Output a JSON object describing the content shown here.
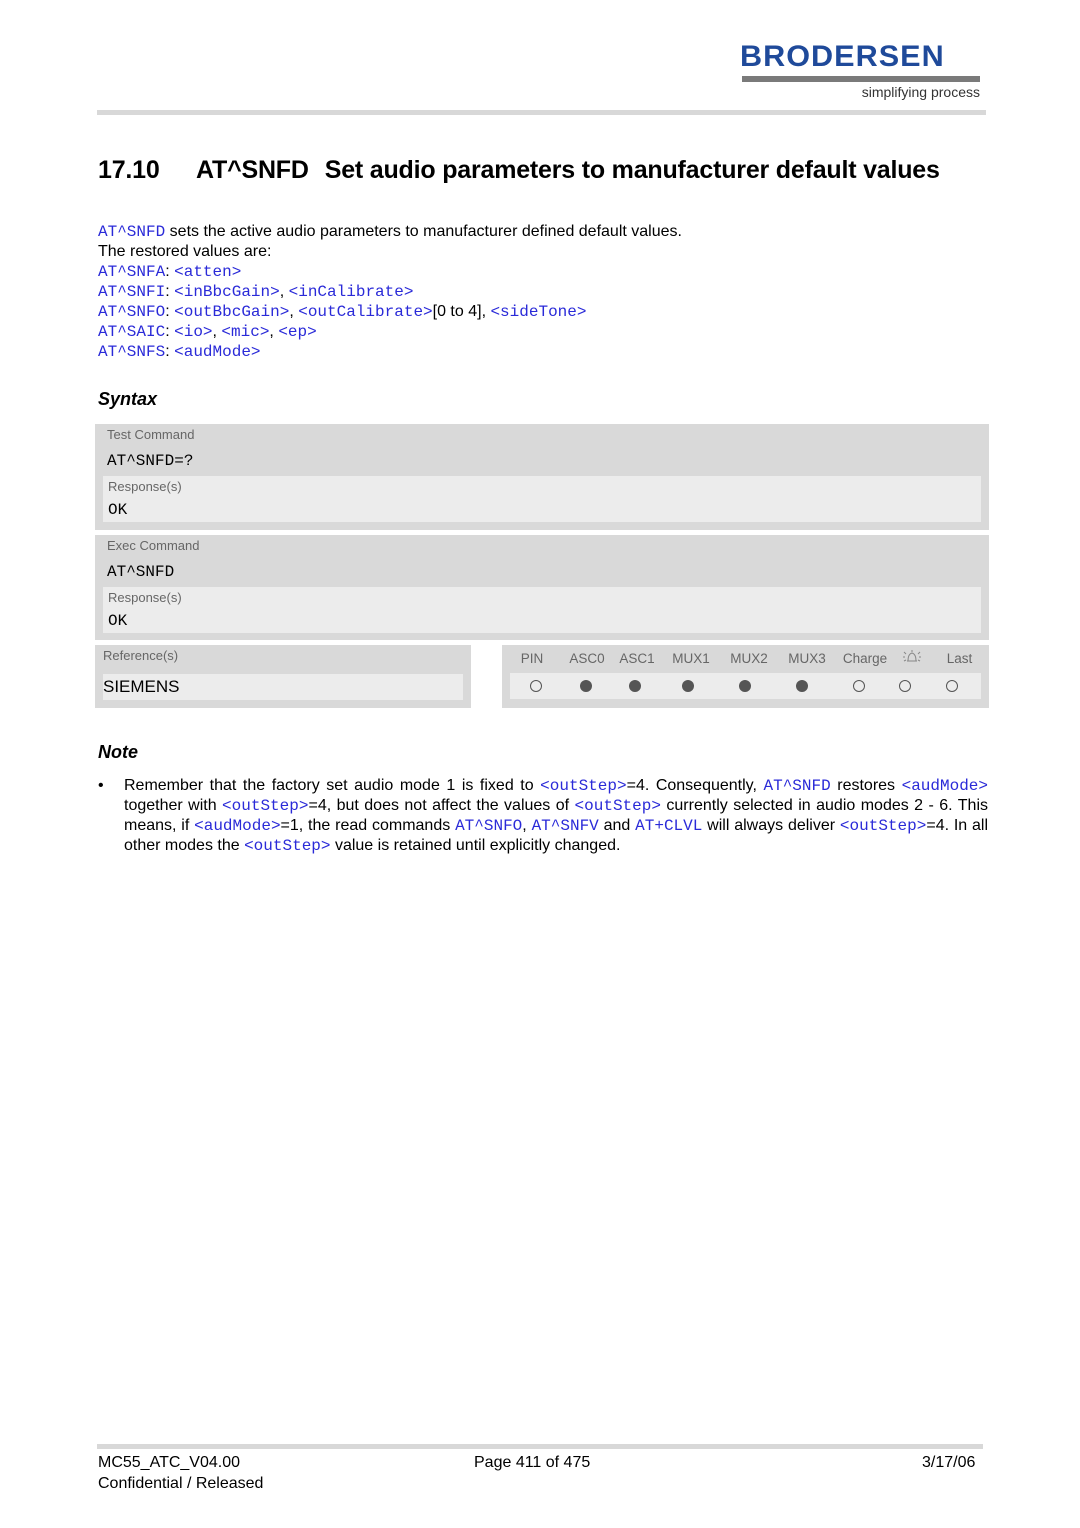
{
  "header": {
    "logo_text": "BRODERSEN",
    "tagline": "simplifying process",
    "brand_color": "#1f4a9a"
  },
  "title": {
    "number": "17.10",
    "command": "AT^SNFD",
    "text": "Set audio parameters to manufacturer default values"
  },
  "intro": {
    "line1_cmd": "AT^SNFD",
    "line1_text": " sets the active audio parameters to manufacturer defined default values.",
    "line2": "The restored values are:",
    "restored": [
      {
        "cmd": "AT^SNFA",
        "params": [
          {
            "t": "<atten>",
            "link": true
          }
        ]
      },
      {
        "cmd": "AT^SNFI",
        "params": [
          {
            "t": "<inBbcGain>",
            "link": true
          },
          {
            "t": ", ",
            "link": false
          },
          {
            "t": "<inCalibrate>",
            "link": true
          }
        ]
      },
      {
        "cmd": "AT^SNFO",
        "params": [
          {
            "t": "<outBbcGain>",
            "link": true
          },
          {
            "t": ", ",
            "link": false
          },
          {
            "t": "<outCalibrate>",
            "link": true
          },
          {
            "t": "[0 to 4], ",
            "link": false
          },
          {
            "t": "<sideTone>",
            "link": true
          }
        ]
      },
      {
        "cmd": "AT^SAIC",
        "params": [
          {
            "t": "<io>",
            "link": true
          },
          {
            "t": ", ",
            "link": false
          },
          {
            "t": "<mic>",
            "link": true
          },
          {
            "t": ", ",
            "link": false
          },
          {
            "t": "<ep>",
            "link": true
          }
        ]
      },
      {
        "cmd": "AT^SNFS",
        "params": [
          {
            "t": "<audMode>",
            "link": true
          }
        ]
      }
    ]
  },
  "syntax": {
    "heading": "Syntax",
    "test": {
      "label": "Test Command",
      "command": "AT^SNFD=?",
      "response_label": "Response(s)",
      "response": "OK"
    },
    "exec": {
      "label": "Exec Command",
      "command": "AT^SNFD",
      "response_label": "Response(s)",
      "response": "OK"
    },
    "reference": {
      "label": "Reference(s)",
      "value": "SIEMENS"
    },
    "flags": {
      "headers": [
        "PIN",
        "ASC0",
        "ASC1",
        "MUX1",
        "MUX2",
        "MUX3",
        "Charge",
        "alarm-bell-icon",
        "Last"
      ],
      "values": [
        false,
        true,
        true,
        true,
        true,
        true,
        false,
        false,
        false
      ]
    }
  },
  "note": {
    "heading": "Note",
    "bullet": "•",
    "segments": [
      {
        "t": "Remember that the factory set audio mode 1 is fixed to ",
        "link": false
      },
      {
        "t": "<outStep>",
        "link": true
      },
      {
        "t": "=4. Consequently, ",
        "link": false
      },
      {
        "t": "AT^SNFD",
        "link": true
      },
      {
        "t": " restores ",
        "link": false
      },
      {
        "t": "<audMode>",
        "link": true
      },
      {
        "t": " together with ",
        "link": false
      },
      {
        "t": "<outStep>",
        "link": true
      },
      {
        "t": "=4, but does not affect the values of ",
        "link": false
      },
      {
        "t": "<outStep>",
        "link": true
      },
      {
        "t": " currently selected in audio modes 2 - 6. This means, if ",
        "link": false
      },
      {
        "t": "<audMode>",
        "link": true
      },
      {
        "t": "=1, the read commands ",
        "link": false
      },
      {
        "t": "AT^SNFO",
        "link": true
      },
      {
        "t": ", ",
        "link": false
      },
      {
        "t": "AT^SNFV",
        "link": true
      },
      {
        "t": " and ",
        "link": false
      },
      {
        "t": "AT+CLVL",
        "link": true
      },
      {
        "t": " will always deliver ",
        "link": false
      },
      {
        "t": "<outStep>",
        "link": true
      },
      {
        "t": "=4. In all other modes the ",
        "link": false
      },
      {
        "t": "<outStep>",
        "link": true
      },
      {
        "t": " value is retained until explicitly changed.",
        "link": false
      }
    ]
  },
  "footer": {
    "doc_id": "MC55_ATC_V04.00",
    "page": "Page 411 of 475",
    "date": "3/17/06",
    "classification": "Confidential / Released"
  },
  "colors": {
    "link": "#2a2ad8",
    "box_dark": "#d9d9d9",
    "box_light": "#ececec"
  }
}
